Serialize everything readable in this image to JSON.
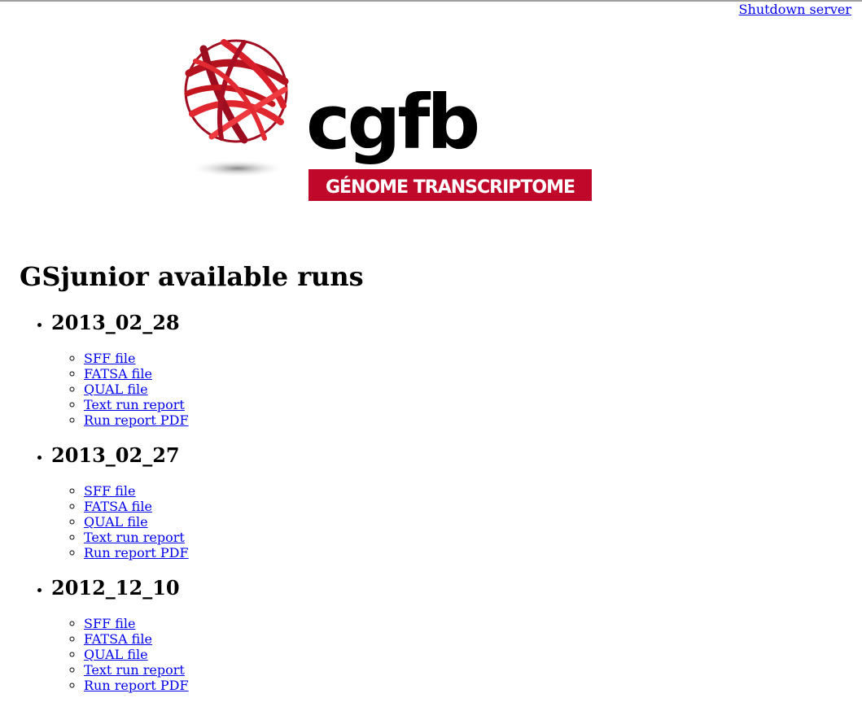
{
  "header": {
    "shutdown_label": "Shutdown server"
  },
  "logo": {
    "name": "cgfb",
    "tagline": "GÉNOME TRANSCRIPTOME",
    "brand_color": "#c0092a"
  },
  "page_title": "GSjunior available runs",
  "runs": [
    {
      "date": "2013_02_28",
      "files": [
        "SFF file",
        "FATSA file",
        "QUAL file",
        "Text run report",
        "Run report PDF"
      ]
    },
    {
      "date": "2013_02_27",
      "files": [
        "SFF file",
        "FATSA file",
        "QUAL file",
        "Text run report",
        "Run report PDF"
      ]
    },
    {
      "date": "2012_12_10",
      "files": [
        "SFF file",
        "FATSA file",
        "QUAL file",
        "Text run report",
        "Run report PDF"
      ]
    }
  ]
}
